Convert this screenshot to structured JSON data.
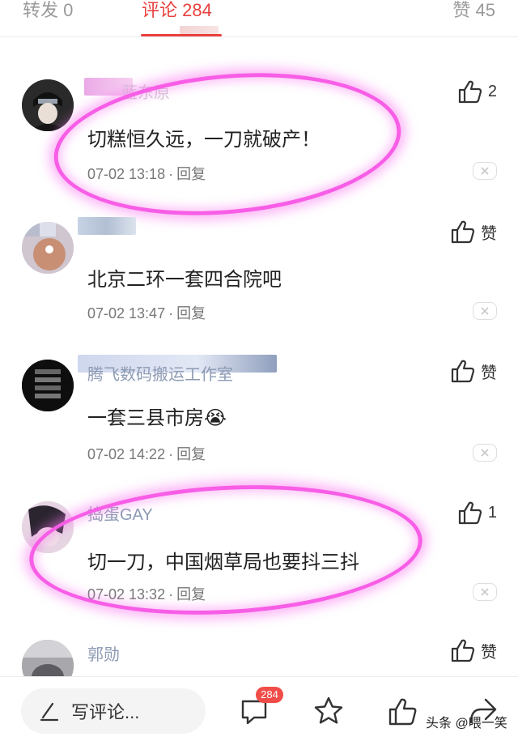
{
  "tabs": {
    "reposts": "转发 0",
    "comments": "评论 284",
    "likes": "赞 45"
  },
  "comments": [
    {
      "username": "蓝东原",
      "text": "切糕恒久远，一刀就破产！",
      "time": "07-02 13:18",
      "reply": "回复",
      "likes": "2",
      "highlighted": true
    },
    {
      "username": "",
      "text": "北京二环一套四合院吧",
      "time": "07-02 13:47",
      "reply": "回复",
      "likes": "赞",
      "highlighted": false
    },
    {
      "username": "腾飞数码搬运工作室",
      "text": "一套三县市房😭",
      "time": "07-02 14:22",
      "reply": "回复",
      "likes": "赞",
      "highlighted": false
    },
    {
      "username": "捣蛋GAY",
      "text": "切一刀，中国烟草局也要抖三抖",
      "time": "07-02 13:32",
      "reply": "回复",
      "likes": "1",
      "highlighted": true
    },
    {
      "username": "郭勋",
      "text": "",
      "time": "",
      "reply": "",
      "likes": "赞",
      "highlighted": false
    }
  ],
  "bottom_bar": {
    "write_placeholder": "写评论...",
    "comment_count_badge": "284"
  },
  "watermark": "头条 @喂一笑",
  "colors": {
    "accent": "#e8403d",
    "highlight_ring": "#f75de6",
    "username": "#8c9ab3"
  }
}
